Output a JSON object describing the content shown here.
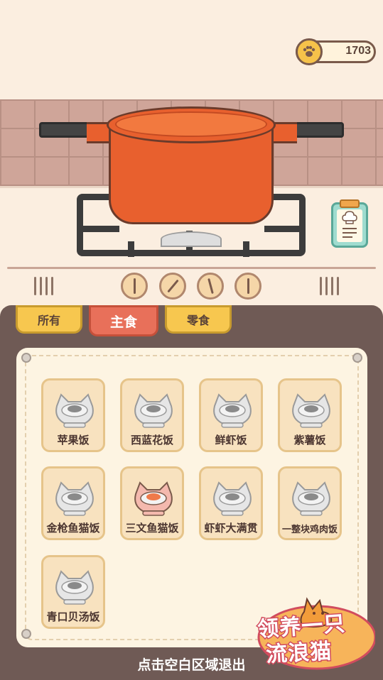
{
  "hud": {
    "coins": "1703",
    "coin_icon": "paw-coin-icon"
  },
  "kitchen": {
    "recipe_icon": "recipe-clipboard-icon",
    "knob_count": 4
  },
  "tabs": [
    {
      "label": "所有",
      "active": false
    },
    {
      "label": "主食",
      "active": true
    },
    {
      "label": "零食",
      "active": false
    }
  ],
  "dishes": [
    {
      "name": "苹果饭",
      "unlocked": false
    },
    {
      "name": "西蓝花饭",
      "unlocked": false
    },
    {
      "name": "鲜虾饭",
      "unlocked": false
    },
    {
      "name": "紫薯饭",
      "unlocked": false
    },
    {
      "name": "金枪鱼猫饭",
      "unlocked": false
    },
    {
      "name": "三文鱼猫饭",
      "unlocked": true
    },
    {
      "name": "虾虾大满贯",
      "unlocked": false
    },
    {
      "name": "一整块鸡肉饭",
      "unlocked": false
    },
    {
      "name": "青口贝汤饭",
      "unlocked": false
    }
  ],
  "footer": {
    "exit_hint": "点击空白区域退出"
  },
  "logo": {
    "line1": "领养一只",
    "line2": "流浪猫"
  },
  "colors": {
    "pot": "#e8602e",
    "panel": "#6f5a55",
    "active_tab": "#e8705a",
    "tab": "#f7c74f",
    "card": "#f8e2bf"
  }
}
